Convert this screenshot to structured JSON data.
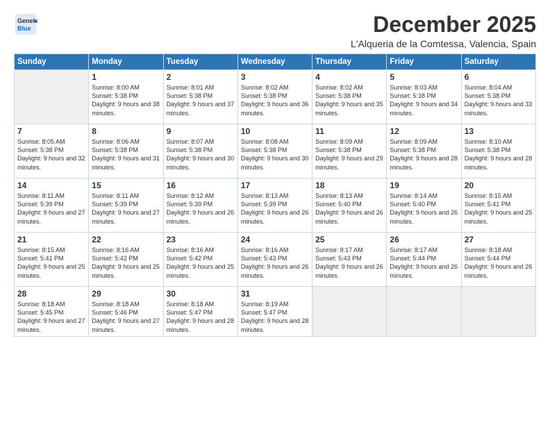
{
  "logo": {
    "line1": "General",
    "line2": "Blue"
  },
  "title": "December 2025",
  "location": "L'Alqueria de la Comtessa, Valencia, Spain",
  "weekdays": [
    "Sunday",
    "Monday",
    "Tuesday",
    "Wednesday",
    "Thursday",
    "Friday",
    "Saturday"
  ],
  "weeks": [
    [
      {
        "day": "",
        "empty": true
      },
      {
        "day": "1",
        "sunrise": "8:00 AM",
        "sunset": "5:38 PM",
        "daylight": "9 hours and 38 minutes."
      },
      {
        "day": "2",
        "sunrise": "8:01 AM",
        "sunset": "5:38 PM",
        "daylight": "9 hours and 37 minutes."
      },
      {
        "day": "3",
        "sunrise": "8:02 AM",
        "sunset": "5:38 PM",
        "daylight": "9 hours and 36 minutes."
      },
      {
        "day": "4",
        "sunrise": "8:02 AM",
        "sunset": "5:38 PM",
        "daylight": "9 hours and 35 minutes."
      },
      {
        "day": "5",
        "sunrise": "8:03 AM",
        "sunset": "5:38 PM",
        "daylight": "9 hours and 34 minutes."
      },
      {
        "day": "6",
        "sunrise": "8:04 AM",
        "sunset": "5:38 PM",
        "daylight": "9 hours and 33 minutes."
      }
    ],
    [
      {
        "day": "7",
        "sunrise": "8:05 AM",
        "sunset": "5:38 PM",
        "daylight": "9 hours and 32 minutes."
      },
      {
        "day": "8",
        "sunrise": "8:06 AM",
        "sunset": "5:38 PM",
        "daylight": "9 hours and 31 minutes."
      },
      {
        "day": "9",
        "sunrise": "8:07 AM",
        "sunset": "5:38 PM",
        "daylight": "9 hours and 30 minutes."
      },
      {
        "day": "10",
        "sunrise": "8:08 AM",
        "sunset": "5:38 PM",
        "daylight": "9 hours and 30 minutes."
      },
      {
        "day": "11",
        "sunrise": "8:09 AM",
        "sunset": "5:38 PM",
        "daylight": "9 hours and 29 minutes."
      },
      {
        "day": "12",
        "sunrise": "8:09 AM",
        "sunset": "5:38 PM",
        "daylight": "9 hours and 28 minutes."
      },
      {
        "day": "13",
        "sunrise": "8:10 AM",
        "sunset": "5:38 PM",
        "daylight": "9 hours and 28 minutes."
      }
    ],
    [
      {
        "day": "14",
        "sunrise": "8:11 AM",
        "sunset": "5:39 PM",
        "daylight": "9 hours and 27 minutes."
      },
      {
        "day": "15",
        "sunrise": "8:11 AM",
        "sunset": "5:39 PM",
        "daylight": "9 hours and 27 minutes."
      },
      {
        "day": "16",
        "sunrise": "8:12 AM",
        "sunset": "5:39 PM",
        "daylight": "9 hours and 26 minutes."
      },
      {
        "day": "17",
        "sunrise": "8:13 AM",
        "sunset": "5:39 PM",
        "daylight": "9 hours and 26 minutes."
      },
      {
        "day": "18",
        "sunrise": "8:13 AM",
        "sunset": "5:40 PM",
        "daylight": "9 hours and 26 minutes."
      },
      {
        "day": "19",
        "sunrise": "8:14 AM",
        "sunset": "5:40 PM",
        "daylight": "9 hours and 26 minutes."
      },
      {
        "day": "20",
        "sunrise": "8:15 AM",
        "sunset": "5:41 PM",
        "daylight": "9 hours and 25 minutes."
      }
    ],
    [
      {
        "day": "21",
        "sunrise": "8:15 AM",
        "sunset": "5:41 PM",
        "daylight": "9 hours and 25 minutes."
      },
      {
        "day": "22",
        "sunrise": "8:16 AM",
        "sunset": "5:42 PM",
        "daylight": "9 hours and 25 minutes."
      },
      {
        "day": "23",
        "sunrise": "8:16 AM",
        "sunset": "5:42 PM",
        "daylight": "9 hours and 25 minutes."
      },
      {
        "day": "24",
        "sunrise": "8:16 AM",
        "sunset": "5:43 PM",
        "daylight": "9 hours and 26 minutes."
      },
      {
        "day": "25",
        "sunrise": "8:17 AM",
        "sunset": "5:43 PM",
        "daylight": "9 hours and 26 minutes."
      },
      {
        "day": "26",
        "sunrise": "8:17 AM",
        "sunset": "5:44 PM",
        "daylight": "9 hours and 26 minutes."
      },
      {
        "day": "27",
        "sunrise": "8:18 AM",
        "sunset": "5:44 PM",
        "daylight": "9 hours and 26 minutes."
      }
    ],
    [
      {
        "day": "28",
        "sunrise": "8:18 AM",
        "sunset": "5:45 PM",
        "daylight": "9 hours and 27 minutes."
      },
      {
        "day": "29",
        "sunrise": "8:18 AM",
        "sunset": "5:46 PM",
        "daylight": "9 hours and 27 minutes."
      },
      {
        "day": "30",
        "sunrise": "8:18 AM",
        "sunset": "5:47 PM",
        "daylight": "9 hours and 28 minutes."
      },
      {
        "day": "31",
        "sunrise": "8:19 AM",
        "sunset": "5:47 PM",
        "daylight": "9 hours and 28 minutes."
      },
      {
        "day": "",
        "empty": true
      },
      {
        "day": "",
        "empty": true
      },
      {
        "day": "",
        "empty": true
      }
    ]
  ],
  "labels": {
    "sunrise": "Sunrise:",
    "sunset": "Sunset:",
    "daylight": "Daylight:"
  }
}
